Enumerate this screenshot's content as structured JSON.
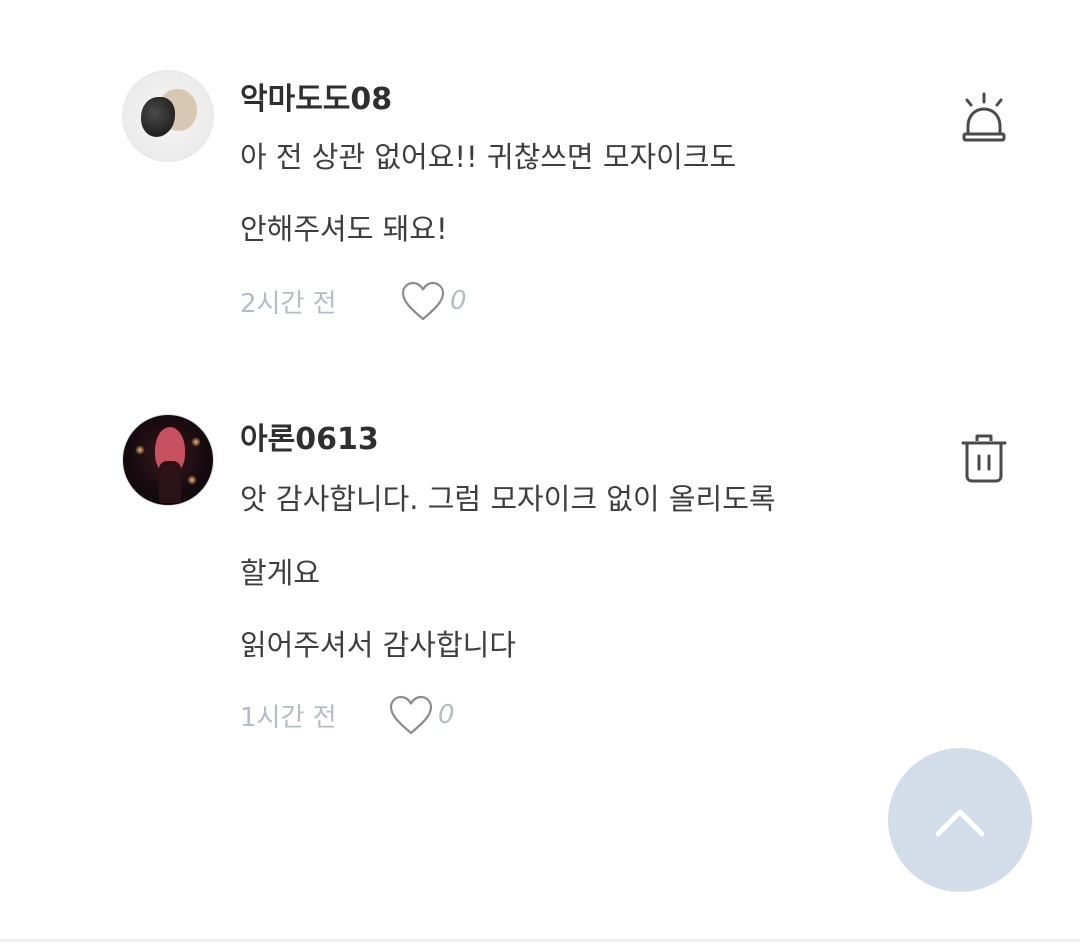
{
  "comments": [
    {
      "author": "악마도도08",
      "lines": [
        "아 전 상관 없어요!! 귀찮쓰면 모자이크도",
        "안해주셔도 돼요!"
      ],
      "time": "2시간 전",
      "likes": "0",
      "action_icon": "siren-icon"
    },
    {
      "author": "아론0613",
      "lines": [
        "앗 감사합니다. 그럼 모자이크 없이 올리도록",
        "할게요",
        "읽어주셔서 감사합니다"
      ],
      "time": "1시간 전",
      "likes": "0",
      "action_icon": "trash-icon"
    }
  ],
  "scroll_top": {
    "icon": "chevron-up-icon"
  },
  "colors": {
    "text": "#3e3e3e",
    "meta": "#b4bcc6",
    "scroll_button_bg": "#d3dde9"
  }
}
